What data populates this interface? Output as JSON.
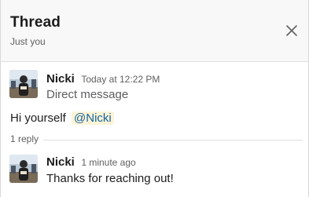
{
  "thread_panel": {
    "title": "Thread",
    "subtitle": "Just you",
    "close_icon": "close-icon"
  },
  "parent_message": {
    "author": "Nicki",
    "timestamp": "Today at 12:22 PM",
    "subtext": "Direct message",
    "body_text": "Hi yourself",
    "mention": "@Nicki"
  },
  "reply_count": "1 reply",
  "reply_message": {
    "author": "Nicki",
    "timestamp": "1 minute ago",
    "body_text": "Thanks for reaching out!"
  },
  "colors": {
    "header_bg": "#f8f8f8",
    "mention_bg": "#fdf4d6",
    "mention_text": "#1264a3",
    "muted_text": "#616061"
  }
}
